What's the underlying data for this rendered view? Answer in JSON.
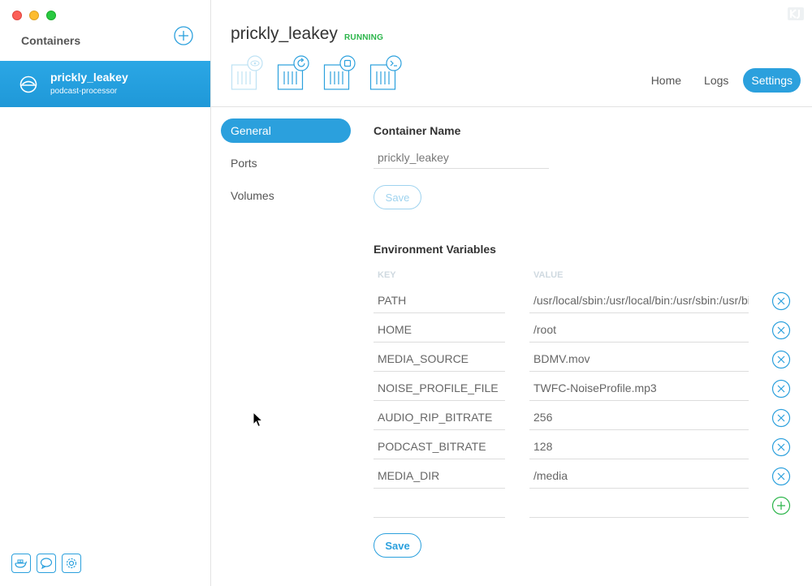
{
  "sidebar": {
    "title": "Containers",
    "containers": [
      {
        "name": "prickly_leakey",
        "image": "podcast-processor"
      }
    ]
  },
  "header": {
    "container_name": "prickly_leakey",
    "status": "RUNNING",
    "status_color": "#2bb54a",
    "actions": [
      "eye-icon",
      "restart-icon",
      "stop-icon",
      "terminal-icon"
    ],
    "tabs": [
      {
        "label": "Home",
        "active": false
      },
      {
        "label": "Logs",
        "active": false
      },
      {
        "label": "Settings",
        "active": true
      }
    ]
  },
  "settings_nav": {
    "items": [
      {
        "label": "General",
        "active": true
      },
      {
        "label": "Ports",
        "active": false
      },
      {
        "label": "Volumes",
        "active": false
      }
    ]
  },
  "general": {
    "container_name_title": "Container Name",
    "container_name_value": "prickly_leakey",
    "save_name_label": "Save",
    "env_title": "Environment Variables",
    "key_header": "KEY",
    "value_header": "VALUE",
    "env": [
      {
        "key": "PATH",
        "value": "/usr/local/sbin:/usr/local/bin:/usr/sbin:/usr/bin:/sbin:/bin"
      },
      {
        "key": "HOME",
        "value": "/root"
      },
      {
        "key": "MEDIA_SOURCE",
        "value": "BDMV.mov"
      },
      {
        "key": "NOISE_PROFILE_FILE",
        "value": "TWFC-NoiseProfile.mp3"
      },
      {
        "key": "AUDIO_RIP_BITRATE",
        "value": "256"
      },
      {
        "key": "PODCAST_BITRATE",
        "value": "128"
      },
      {
        "key": "MEDIA_DIR",
        "value": "/media"
      }
    ],
    "new_key": "",
    "new_value": "",
    "save_env_label": "Save"
  },
  "colors": {
    "accent": "#2ba0dd",
    "remove": "#2ba0dd",
    "add": "#2bb54a"
  }
}
